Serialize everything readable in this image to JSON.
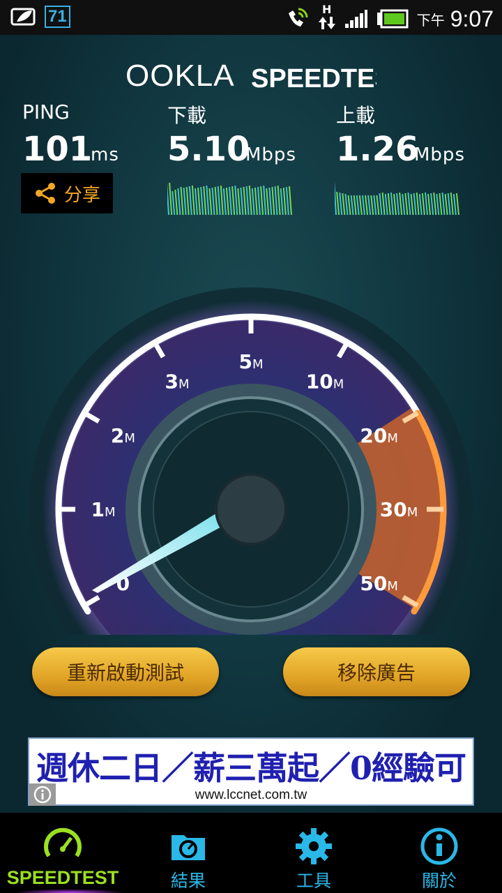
{
  "status_bar": {
    "badge": "71",
    "network": "H",
    "ampm": "下午",
    "time": "9:07"
  },
  "brand": {
    "logo": "OOKLA",
    "product": "SPEEDTEST"
  },
  "results": {
    "ping": {
      "label": "PING",
      "value": "101",
      "unit": "ms"
    },
    "download": {
      "label": "下載",
      "value": "5.10",
      "unit": "Mbps"
    },
    "upload": {
      "label": "上載",
      "value": "1.26",
      "unit": "Mbps"
    }
  },
  "share": {
    "label": "分享",
    "icon": "share-icon"
  },
  "gauge": {
    "ticks": [
      {
        "num": "0",
        "unit": ""
      },
      {
        "num": "1",
        "unit": "M"
      },
      {
        "num": "2",
        "unit": "M"
      },
      {
        "num": "3",
        "unit": "M"
      },
      {
        "num": "5",
        "unit": "M"
      },
      {
        "num": "10",
        "unit": "M"
      },
      {
        "num": "20",
        "unit": "M"
      },
      {
        "num": "30",
        "unit": "M"
      },
      {
        "num": "50",
        "unit": "M"
      }
    ]
  },
  "actions": {
    "restart": "重新啟動測試",
    "remove_ads": "移除廣告"
  },
  "ad": {
    "headline": "週休二日／薪三萬起／0經驗可",
    "url": "www.lccnet.com.tw"
  },
  "nav": [
    {
      "label": "SPEEDTEST",
      "icon": "speedometer-icon",
      "active": true
    },
    {
      "label": "結果",
      "icon": "results-icon",
      "active": false
    },
    {
      "label": "工具",
      "icon": "gear-icon",
      "active": false
    },
    {
      "label": "關於",
      "icon": "info-icon",
      "active": false
    }
  ],
  "colors": {
    "accent_green": "#9be020",
    "accent_blue": "#2ab8e8",
    "button_gold": "#e2a526",
    "share_orange": "#f5a623"
  }
}
